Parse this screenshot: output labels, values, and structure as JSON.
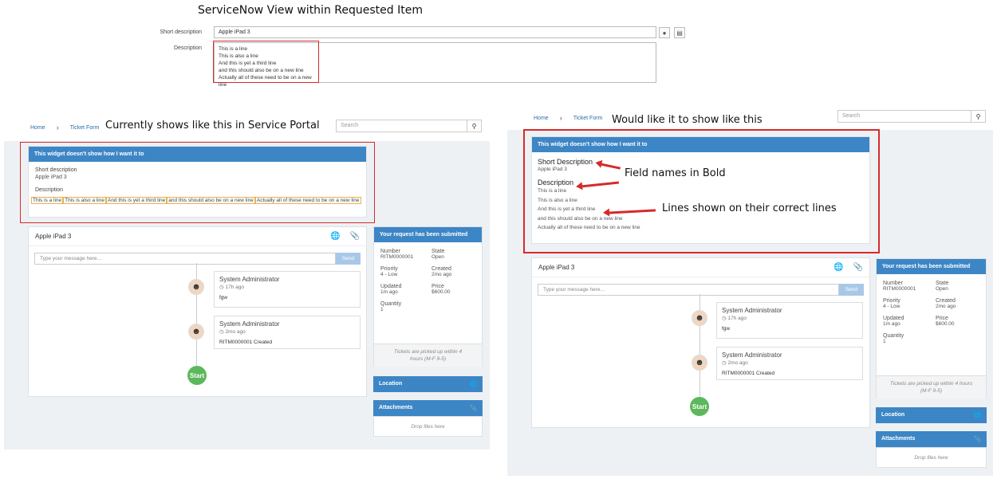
{
  "top": {
    "title": "ServiceNow View within Requested Item",
    "short_label": "Short description",
    "short_value": "Apple iPad 3",
    "desc_label": "Description",
    "desc_lines": [
      "This is a line",
      "This is also a line",
      "And this is yet a third line",
      "and this should also be on a new line",
      "Actually all of these need to be on a new line"
    ]
  },
  "left": {
    "caption": "Currently shows like this in Service Portal",
    "crumb_home": "Home",
    "crumb_form": "Ticket Form",
    "search_placeholder": "Search",
    "widget_title": "This widget doesn't show how I want it to",
    "short_label": "Short description",
    "short_value": "Apple iPad 3",
    "desc_label": "Description",
    "desc_lines": [
      "This is a line",
      "This is also a line",
      "And this is yet a third line",
      "and this should also be on a new line",
      "Actually all of these need to be on a new line"
    ]
  },
  "right": {
    "caption": "Would like it to show like this",
    "crumb_home": "Home",
    "crumb_form": "Ticket Form",
    "search_placeholder": "Search",
    "widget_title": "This widget doesn't show how I want it to",
    "short_label": "Short Description",
    "short_value": "Apple iPad 3",
    "desc_label": "Description",
    "desc_lines": [
      "This is a line",
      "This is also a line",
      "And this is yet a third line",
      "and this should also be on a new line",
      "Actually all of these need to be on a new line"
    ],
    "annot1": "Field names in Bold",
    "annot2": "Lines shown on their correct lines"
  },
  "ticket": {
    "item": "Apple iPad 3",
    "msg_placeholder": "Type your message here...",
    "send": "Send",
    "entries": [
      {
        "name": "System Administrator",
        "time": "17h ago",
        "text": "fgw"
      },
      {
        "name": "System Administrator",
        "time": "2mo ago",
        "text": "RITM0000001 Created"
      }
    ],
    "start": "Start",
    "submitted": "Your request has been submitted",
    "fields": [
      {
        "label": "Number",
        "value": "RITM0000001"
      },
      {
        "label": "State",
        "value": "Open"
      },
      {
        "label": "Priority",
        "value": "4 - Low"
      },
      {
        "label": "Created",
        "value": "2mo ago"
      },
      {
        "label": "Updated",
        "value": "1m ago"
      },
      {
        "label": "Price",
        "value": "$600.00"
      },
      {
        "label": "Quantity",
        "value": "1"
      }
    ],
    "pickup": "Tickets are picked up within 4 hours (M-F 9-5)",
    "location": "Location",
    "attachments": "Attachments",
    "drop": "Drop files here"
  }
}
